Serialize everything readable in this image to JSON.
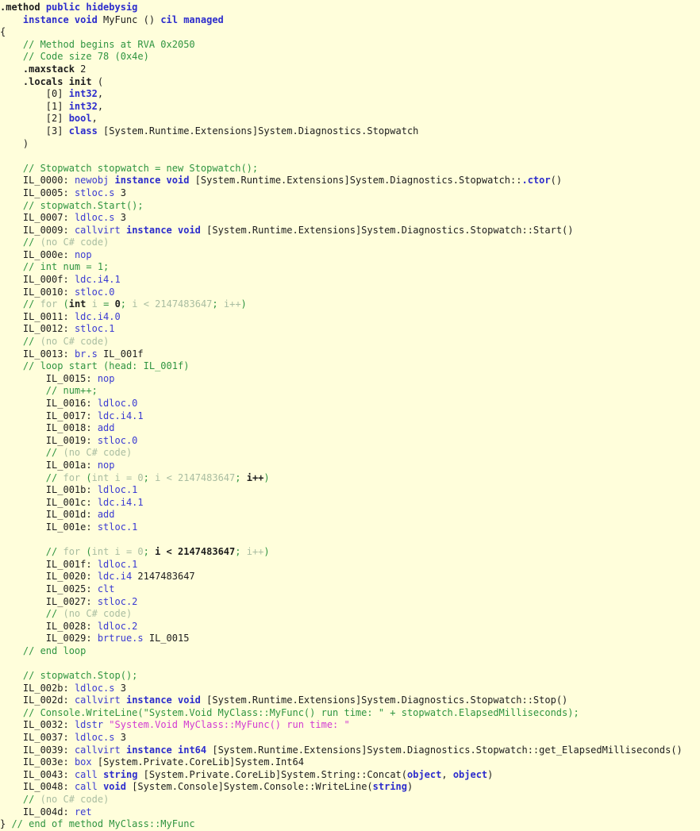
{
  "document": {
    "kind": "il-disassembly",
    "title": "MyClass::MyFunc",
    "background_color": "#fffedb",
    "colors": {
      "keyword": "#2c2ccc",
      "opcode": "#3a3ad2",
      "comment": "#2e9440",
      "comment_dim": "#a9bda1",
      "comment_highlight": "#1d1d1d",
      "string": "#d23ad2",
      "plain": "#1d1d1d"
    }
  },
  "lines": [
    {
      "id": "l001",
      "indent": 0,
      "tokens": [
        {
          "t": ".method",
          "c": "dirw"
        },
        {
          "t": " ",
          "c": "plain"
        },
        {
          "t": "public hidebysig",
          "c": "kw"
        }
      ]
    },
    {
      "id": "l002",
      "indent": 1,
      "tokens": [
        {
          "t": "instance void",
          "c": "kw"
        },
        {
          "t": " MyFunc () ",
          "c": "plain"
        },
        {
          "t": "cil managed",
          "c": "kw"
        }
      ]
    },
    {
      "id": "l003",
      "indent": 0,
      "tokens": [
        {
          "t": "{",
          "c": "plain"
        }
      ]
    },
    {
      "id": "l004",
      "indent": 1,
      "tokens": [
        {
          "t": "// Method begins at RVA 0x2050",
          "c": "cmt"
        }
      ]
    },
    {
      "id": "l005",
      "indent": 1,
      "tokens": [
        {
          "t": "// Code size 78 (0x4e)",
          "c": "cmt"
        }
      ]
    },
    {
      "id": "l006",
      "indent": 1,
      "tokens": [
        {
          "t": ".maxstack",
          "c": "dirw"
        },
        {
          "t": " 2",
          "c": "plain"
        }
      ]
    },
    {
      "id": "l007",
      "indent": 1,
      "tokens": [
        {
          "t": ".locals init",
          "c": "dirw"
        },
        {
          "t": " (",
          "c": "plain"
        }
      ]
    },
    {
      "id": "l008",
      "indent": 2,
      "tokens": [
        {
          "t": "[0] ",
          "c": "plain"
        },
        {
          "t": "int32",
          "c": "kw"
        },
        {
          "t": ",",
          "c": "plain"
        }
      ]
    },
    {
      "id": "l009",
      "indent": 2,
      "tokens": [
        {
          "t": "[1] ",
          "c": "plain"
        },
        {
          "t": "int32",
          "c": "kw"
        },
        {
          "t": ",",
          "c": "plain"
        }
      ]
    },
    {
      "id": "l010",
      "indent": 2,
      "tokens": [
        {
          "t": "[2] ",
          "c": "plain"
        },
        {
          "t": "bool",
          "c": "kw"
        },
        {
          "t": ",",
          "c": "plain"
        }
      ]
    },
    {
      "id": "l011",
      "indent": 2,
      "tokens": [
        {
          "t": "[3] ",
          "c": "plain"
        },
        {
          "t": "class",
          "c": "kw"
        },
        {
          "t": " [System.Runtime.Extensions]System.Diagnostics.Stopwatch",
          "c": "plain"
        }
      ]
    },
    {
      "id": "l012",
      "indent": 1,
      "tokens": [
        {
          "t": ")",
          "c": "plain"
        }
      ]
    },
    {
      "id": "l013",
      "indent": 0,
      "tokens": []
    },
    {
      "id": "l014",
      "indent": 1,
      "tokens": [
        {
          "t": "// Stopwatch stopwatch = new Stopwatch();",
          "c": "cmt"
        }
      ]
    },
    {
      "id": "l015",
      "indent": 1,
      "tokens": [
        {
          "t": "IL_0000: ",
          "c": "lbl"
        },
        {
          "t": "newobj",
          "c": "op"
        },
        {
          "t": " ",
          "c": "plain"
        },
        {
          "t": "instance void",
          "c": "kw"
        },
        {
          "t": " [System.Runtime.Extensions]System.Diagnostics.Stopwatch::",
          "c": "plain"
        },
        {
          "t": ".ctor",
          "c": "kw"
        },
        {
          "t": "()",
          "c": "plain"
        }
      ]
    },
    {
      "id": "l016",
      "indent": 1,
      "tokens": [
        {
          "t": "IL_0005: ",
          "c": "lbl"
        },
        {
          "t": "stloc.s",
          "c": "op"
        },
        {
          "t": " 3",
          "c": "plain"
        }
      ]
    },
    {
      "id": "l017",
      "indent": 1,
      "tokens": [
        {
          "t": "// stopwatch.Start();",
          "c": "cmt"
        }
      ]
    },
    {
      "id": "l018",
      "indent": 1,
      "tokens": [
        {
          "t": "IL_0007: ",
          "c": "lbl"
        },
        {
          "t": "ldloc.s",
          "c": "op"
        },
        {
          "t": " 3",
          "c": "plain"
        }
      ]
    },
    {
      "id": "l019",
      "indent": 1,
      "tokens": [
        {
          "t": "IL_0009: ",
          "c": "lbl"
        },
        {
          "t": "callvirt",
          "c": "op"
        },
        {
          "t": " ",
          "c": "plain"
        },
        {
          "t": "instance void",
          "c": "kw"
        },
        {
          "t": " [System.Runtime.Extensions]System.Diagnostics.Stopwatch::Start()",
          "c": "plain"
        }
      ]
    },
    {
      "id": "l020",
      "indent": 1,
      "tokens": [
        {
          "t": "// ",
          "c": "cmt"
        },
        {
          "t": "(no C# code)",
          "c": "cmtdim"
        }
      ]
    },
    {
      "id": "l021",
      "indent": 1,
      "tokens": [
        {
          "t": "IL_000e: ",
          "c": "lbl"
        },
        {
          "t": "nop",
          "c": "op"
        }
      ]
    },
    {
      "id": "l022",
      "indent": 1,
      "tokens": [
        {
          "t": "// int num = 1;",
          "c": "cmt"
        }
      ]
    },
    {
      "id": "l023",
      "indent": 1,
      "tokens": [
        {
          "t": "IL_000f: ",
          "c": "lbl"
        },
        {
          "t": "ldc.i4.1",
          "c": "op"
        }
      ]
    },
    {
      "id": "l024",
      "indent": 1,
      "tokens": [
        {
          "t": "IL_0010: ",
          "c": "lbl"
        },
        {
          "t": "stloc.0",
          "c": "op"
        }
      ]
    },
    {
      "id": "l025",
      "indent": 1,
      "tokens": [
        {
          "t": "// ",
          "c": "cmt"
        },
        {
          "t": "for ",
          "c": "cmtdim"
        },
        {
          "t": "(",
          "c": "cmt"
        },
        {
          "t": "int",
          "c": "cmthot"
        },
        {
          "t": " i ",
          "c": "cmtdim"
        },
        {
          "t": "= ",
          "c": "cmt"
        },
        {
          "t": "0",
          "c": "cmthot"
        },
        {
          "t": ";",
          "c": "cmt"
        },
        {
          "t": " i < 2147483647",
          "c": "cmtdim"
        },
        {
          "t": ";",
          "c": "cmt"
        },
        {
          "t": " i++",
          "c": "cmtdim"
        },
        {
          "t": ")",
          "c": "cmt"
        }
      ]
    },
    {
      "id": "l026",
      "indent": 1,
      "tokens": [
        {
          "t": "IL_0011: ",
          "c": "lbl"
        },
        {
          "t": "ldc.i4.0",
          "c": "op"
        }
      ]
    },
    {
      "id": "l027",
      "indent": 1,
      "tokens": [
        {
          "t": "IL_0012: ",
          "c": "lbl"
        },
        {
          "t": "stloc.1",
          "c": "op"
        }
      ]
    },
    {
      "id": "l028",
      "indent": 1,
      "tokens": [
        {
          "t": "// ",
          "c": "cmt"
        },
        {
          "t": "(no C# code)",
          "c": "cmtdim"
        }
      ]
    },
    {
      "id": "l029",
      "indent": 1,
      "tokens": [
        {
          "t": "IL_0013: ",
          "c": "lbl"
        },
        {
          "t": "br.s",
          "c": "op"
        },
        {
          "t": " IL_001f",
          "c": "plain"
        }
      ]
    },
    {
      "id": "l030",
      "indent": 1,
      "tokens": [
        {
          "t": "// loop start (head: IL_001f)",
          "c": "cmt"
        }
      ]
    },
    {
      "id": "l031",
      "indent": 2,
      "tokens": [
        {
          "t": "IL_0015: ",
          "c": "lbl"
        },
        {
          "t": "nop",
          "c": "op"
        }
      ]
    },
    {
      "id": "l032",
      "indent": 2,
      "tokens": [
        {
          "t": "// num++;",
          "c": "cmt"
        }
      ]
    },
    {
      "id": "l033",
      "indent": 2,
      "tokens": [
        {
          "t": "IL_0016: ",
          "c": "lbl"
        },
        {
          "t": "ldloc.0",
          "c": "op"
        }
      ]
    },
    {
      "id": "l034",
      "indent": 2,
      "tokens": [
        {
          "t": "IL_0017: ",
          "c": "lbl"
        },
        {
          "t": "ldc.i4.1",
          "c": "op"
        }
      ]
    },
    {
      "id": "l035",
      "indent": 2,
      "tokens": [
        {
          "t": "IL_0018: ",
          "c": "lbl"
        },
        {
          "t": "add",
          "c": "op"
        }
      ]
    },
    {
      "id": "l036",
      "indent": 2,
      "tokens": [
        {
          "t": "IL_0019: ",
          "c": "lbl"
        },
        {
          "t": "stloc.0",
          "c": "op"
        }
      ]
    },
    {
      "id": "l037",
      "indent": 2,
      "tokens": [
        {
          "t": "// ",
          "c": "cmt"
        },
        {
          "t": "(no C# code)",
          "c": "cmtdim"
        }
      ]
    },
    {
      "id": "l038",
      "indent": 2,
      "tokens": [
        {
          "t": "IL_001a: ",
          "c": "lbl"
        },
        {
          "t": "nop",
          "c": "op"
        }
      ]
    },
    {
      "id": "l039",
      "indent": 2,
      "tokens": [
        {
          "t": "// ",
          "c": "cmt"
        },
        {
          "t": "for ",
          "c": "cmtdim"
        },
        {
          "t": "(",
          "c": "cmt"
        },
        {
          "t": "int i = 0",
          "c": "cmtdim"
        },
        {
          "t": ";",
          "c": "cmt"
        },
        {
          "t": " i < 2147483647",
          "c": "cmtdim"
        },
        {
          "t": "; ",
          "c": "cmt"
        },
        {
          "t": "i++",
          "c": "cmthot"
        },
        {
          "t": ")",
          "c": "cmt"
        }
      ]
    },
    {
      "id": "l040",
      "indent": 2,
      "tokens": [
        {
          "t": "IL_001b: ",
          "c": "lbl"
        },
        {
          "t": "ldloc.1",
          "c": "op"
        }
      ]
    },
    {
      "id": "l041",
      "indent": 2,
      "tokens": [
        {
          "t": "IL_001c: ",
          "c": "lbl"
        },
        {
          "t": "ldc.i4.1",
          "c": "op"
        }
      ]
    },
    {
      "id": "l042",
      "indent": 2,
      "tokens": [
        {
          "t": "IL_001d: ",
          "c": "lbl"
        },
        {
          "t": "add",
          "c": "op"
        }
      ]
    },
    {
      "id": "l043",
      "indent": 2,
      "tokens": [
        {
          "t": "IL_001e: ",
          "c": "lbl"
        },
        {
          "t": "stloc.1",
          "c": "op"
        }
      ]
    },
    {
      "id": "l044",
      "indent": 0,
      "tokens": []
    },
    {
      "id": "l045",
      "indent": 2,
      "tokens": [
        {
          "t": "// ",
          "c": "cmt"
        },
        {
          "t": "for ",
          "c": "cmtdim"
        },
        {
          "t": "(",
          "c": "cmt"
        },
        {
          "t": "int i = 0",
          "c": "cmtdim"
        },
        {
          "t": "; ",
          "c": "cmt"
        },
        {
          "t": "i < 2147483647",
          "c": "cmthot"
        },
        {
          "t": ";",
          "c": "cmt"
        },
        {
          "t": " i++",
          "c": "cmtdim"
        },
        {
          "t": ")",
          "c": "cmt"
        }
      ]
    },
    {
      "id": "l046",
      "indent": 2,
      "tokens": [
        {
          "t": "IL_001f: ",
          "c": "lbl"
        },
        {
          "t": "ldloc.1",
          "c": "op"
        }
      ]
    },
    {
      "id": "l047",
      "indent": 2,
      "tokens": [
        {
          "t": "IL_0020: ",
          "c": "lbl"
        },
        {
          "t": "ldc.i4",
          "c": "op"
        },
        {
          "t": " 2147483647",
          "c": "num"
        }
      ]
    },
    {
      "id": "l048",
      "indent": 2,
      "tokens": [
        {
          "t": "IL_0025: ",
          "c": "lbl"
        },
        {
          "t": "clt",
          "c": "op"
        }
      ]
    },
    {
      "id": "l049",
      "indent": 2,
      "tokens": [
        {
          "t": "IL_0027: ",
          "c": "lbl"
        },
        {
          "t": "stloc.2",
          "c": "op"
        }
      ]
    },
    {
      "id": "l050",
      "indent": 2,
      "tokens": [
        {
          "t": "// ",
          "c": "cmt"
        },
        {
          "t": "(no C# code)",
          "c": "cmtdim"
        }
      ]
    },
    {
      "id": "l051",
      "indent": 2,
      "tokens": [
        {
          "t": "IL_0028: ",
          "c": "lbl"
        },
        {
          "t": "ldloc.2",
          "c": "op"
        }
      ]
    },
    {
      "id": "l052",
      "indent": 2,
      "tokens": [
        {
          "t": "IL_0029: ",
          "c": "lbl"
        },
        {
          "t": "brtrue.s",
          "c": "op"
        },
        {
          "t": " IL_0015",
          "c": "plain"
        }
      ]
    },
    {
      "id": "l053",
      "indent": 1,
      "tokens": [
        {
          "t": "// end loop",
          "c": "cmt"
        }
      ]
    },
    {
      "id": "l054",
      "indent": 0,
      "tokens": []
    },
    {
      "id": "l055",
      "indent": 1,
      "tokens": [
        {
          "t": "// stopwatch.Stop();",
          "c": "cmt"
        }
      ]
    },
    {
      "id": "l056",
      "indent": 1,
      "tokens": [
        {
          "t": "IL_002b: ",
          "c": "lbl"
        },
        {
          "t": "ldloc.s",
          "c": "op"
        },
        {
          "t": " 3",
          "c": "plain"
        }
      ]
    },
    {
      "id": "l057",
      "indent": 1,
      "tokens": [
        {
          "t": "IL_002d: ",
          "c": "lbl"
        },
        {
          "t": "callvirt",
          "c": "op"
        },
        {
          "t": " ",
          "c": "plain"
        },
        {
          "t": "instance void",
          "c": "kw"
        },
        {
          "t": " [System.Runtime.Extensions]System.Diagnostics.Stopwatch::Stop()",
          "c": "plain"
        }
      ]
    },
    {
      "id": "l058",
      "indent": 1,
      "tokens": [
        {
          "t": "// Console.WriteLine(\"System.Void MyClass::MyFunc() run time: \" + stopwatch.ElapsedMilliseconds);",
          "c": "cmt"
        }
      ]
    },
    {
      "id": "l059",
      "indent": 1,
      "tokens": [
        {
          "t": "IL_0032: ",
          "c": "lbl"
        },
        {
          "t": "ldstr",
          "c": "op"
        },
        {
          "t": " ",
          "c": "plain"
        },
        {
          "t": "\"System.Void MyClass::MyFunc() run time: \"",
          "c": "str"
        }
      ]
    },
    {
      "id": "l060",
      "indent": 1,
      "tokens": [
        {
          "t": "IL_0037: ",
          "c": "lbl"
        },
        {
          "t": "ldloc.s",
          "c": "op"
        },
        {
          "t": " 3",
          "c": "plain"
        }
      ]
    },
    {
      "id": "l061",
      "indent": 1,
      "tokens": [
        {
          "t": "IL_0039: ",
          "c": "lbl"
        },
        {
          "t": "callvirt",
          "c": "op"
        },
        {
          "t": " ",
          "c": "plain"
        },
        {
          "t": "instance int64",
          "c": "kw"
        },
        {
          "t": " [System.Runtime.Extensions]System.Diagnostics.Stopwatch::get_ElapsedMilliseconds()",
          "c": "plain"
        }
      ]
    },
    {
      "id": "l062",
      "indent": 1,
      "tokens": [
        {
          "t": "IL_003e: ",
          "c": "lbl"
        },
        {
          "t": "box",
          "c": "op"
        },
        {
          "t": " [System.Private.CoreLib]System.Int64",
          "c": "plain"
        }
      ]
    },
    {
      "id": "l063",
      "indent": 1,
      "tokens": [
        {
          "t": "IL_0043: ",
          "c": "lbl"
        },
        {
          "t": "call",
          "c": "op"
        },
        {
          "t": " ",
          "c": "plain"
        },
        {
          "t": "string",
          "c": "kw"
        },
        {
          "t": " [System.Private.CoreLib]System.String::Concat(",
          "c": "plain"
        },
        {
          "t": "object",
          "c": "kw"
        },
        {
          "t": ", ",
          "c": "plain"
        },
        {
          "t": "object",
          "c": "kw"
        },
        {
          "t": ")",
          "c": "plain"
        }
      ]
    },
    {
      "id": "l064",
      "indent": 1,
      "tokens": [
        {
          "t": "IL_0048: ",
          "c": "lbl"
        },
        {
          "t": "call",
          "c": "op"
        },
        {
          "t": " ",
          "c": "plain"
        },
        {
          "t": "void",
          "c": "kw"
        },
        {
          "t": " [System.Console]System.Console::WriteLine(",
          "c": "plain"
        },
        {
          "t": "string",
          "c": "kw"
        },
        {
          "t": ")",
          "c": "plain"
        }
      ]
    },
    {
      "id": "l065",
      "indent": 1,
      "tokens": [
        {
          "t": "// ",
          "c": "cmt"
        },
        {
          "t": "(no C# code)",
          "c": "cmtdim"
        }
      ]
    },
    {
      "id": "l066",
      "indent": 1,
      "tokens": [
        {
          "t": "IL_004d: ",
          "c": "lbl"
        },
        {
          "t": "ret",
          "c": "op"
        }
      ]
    },
    {
      "id": "l067",
      "indent": 0,
      "tokens": [
        {
          "t": "}",
          "c": "plain"
        },
        {
          "t": " // end of method MyClass::MyFunc",
          "c": "cmt"
        }
      ]
    }
  ]
}
